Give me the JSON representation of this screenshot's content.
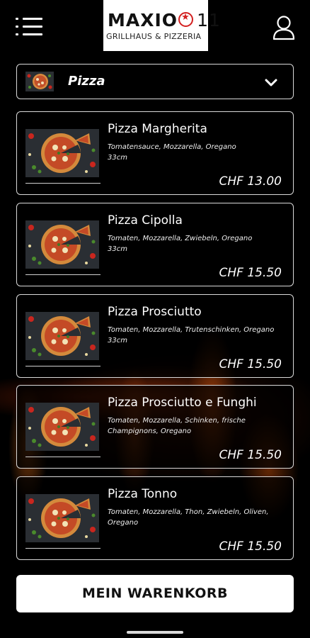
{
  "header": {
    "logo_name": "MAXIO",
    "logo_number": "11",
    "logo_subtitle": "GRILLHAUS & PIZZERIA",
    "menu_icon": "hamburger-menu-icon",
    "profile_icon": "user-icon"
  },
  "category": {
    "label": "Pizza",
    "dropdown_icon": "chevron-down-icon"
  },
  "products": [
    {
      "name": "Pizza Margherita",
      "description": "Tomatensauce, Mozzarella, Oregano",
      "size": "33cm",
      "price": "CHF 13.00"
    },
    {
      "name": "Pizza Cipolla",
      "description": "Tomaten, Mozzarella, Zwiebeln, Oregano",
      "size": "33cm",
      "price": "CHF 15.50"
    },
    {
      "name": "Pizza Prosciutto",
      "description": "Tomaten, Mozzarella, Trutenschinken, Oregano",
      "size": "33cm",
      "price": "CHF 15.50"
    },
    {
      "name": "Pizza Prosciutto e Funghi",
      "description": "Tomaten, Mozzarella, Schinken, frische Champignons, Oregano",
      "size": "",
      "price": "CHF 15.50"
    },
    {
      "name": "Pizza Tonno",
      "description": "Tomaten, Mozzarella, Thon, Zwiebeln, Oliven, Oregano",
      "size": "",
      "price": "CHF 15.50"
    }
  ],
  "cart_button": {
    "label": "MEIN WARENKORB"
  },
  "colors": {
    "background": "#000000",
    "card_border": "#d9d9d9",
    "logo_accent": "#d31f1f",
    "button_bg": "#ffffff"
  }
}
